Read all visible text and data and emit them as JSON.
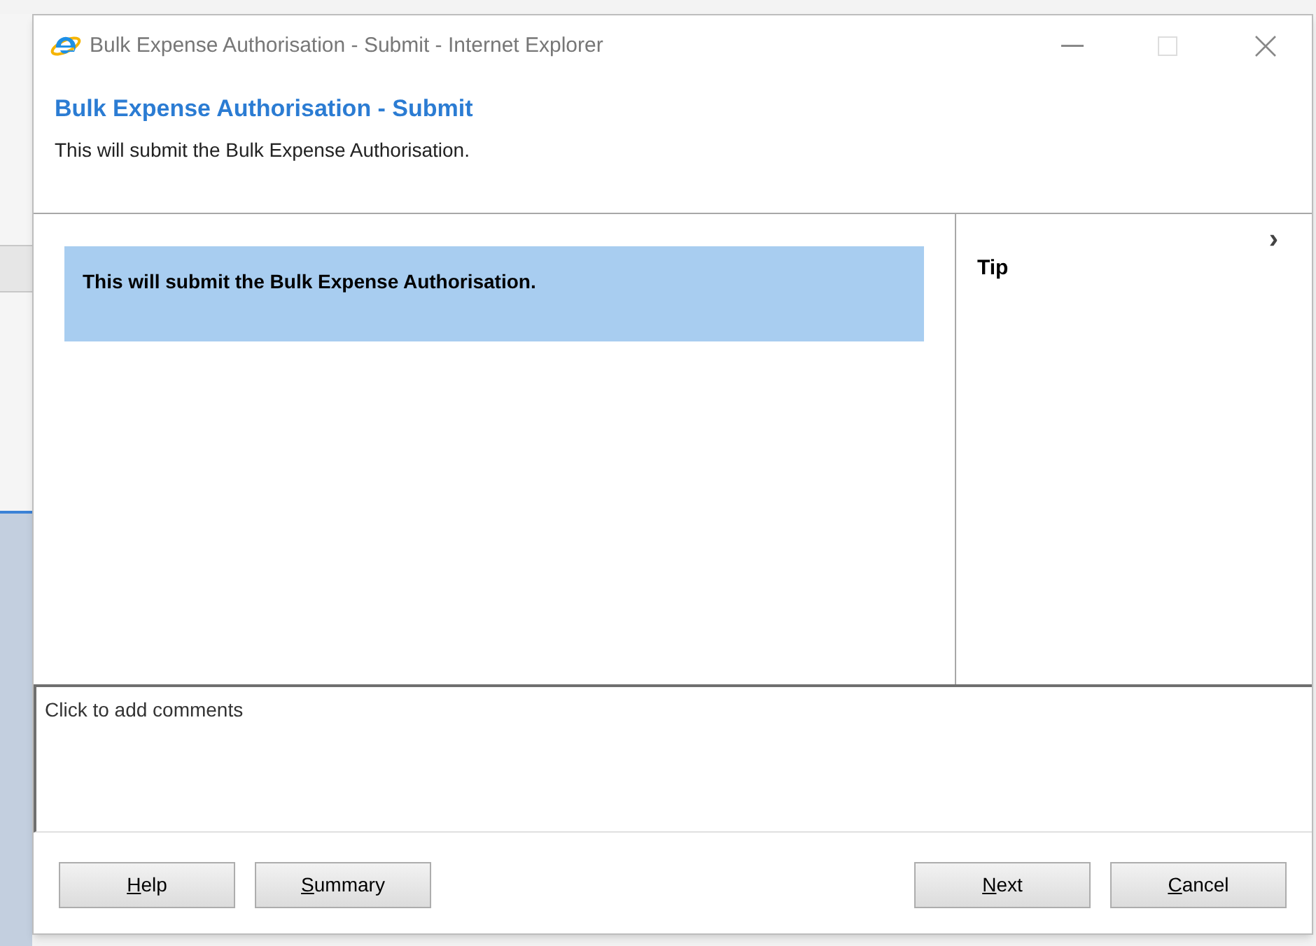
{
  "window": {
    "title": "Bulk Expense Authorisation - Submit - Internet Explorer"
  },
  "header": {
    "title": "Bulk Expense Authorisation - Submit",
    "subtitle": "This will submit the Bulk Expense Authorisation."
  },
  "message": "This will submit the Bulk Expense Authorisation.",
  "tip_pane": {
    "title": "Tip",
    "collapse_glyph": "›"
  },
  "comments": {
    "placeholder": "Click to add comments"
  },
  "buttons_left": [
    {
      "label": "Help",
      "underline_first": true
    },
    {
      "label": "Summary",
      "underline_first": true
    }
  ],
  "buttons_right": [
    {
      "label": "Next",
      "underline_first": true
    },
    {
      "label": "Cancel",
      "underline_first": true
    }
  ]
}
